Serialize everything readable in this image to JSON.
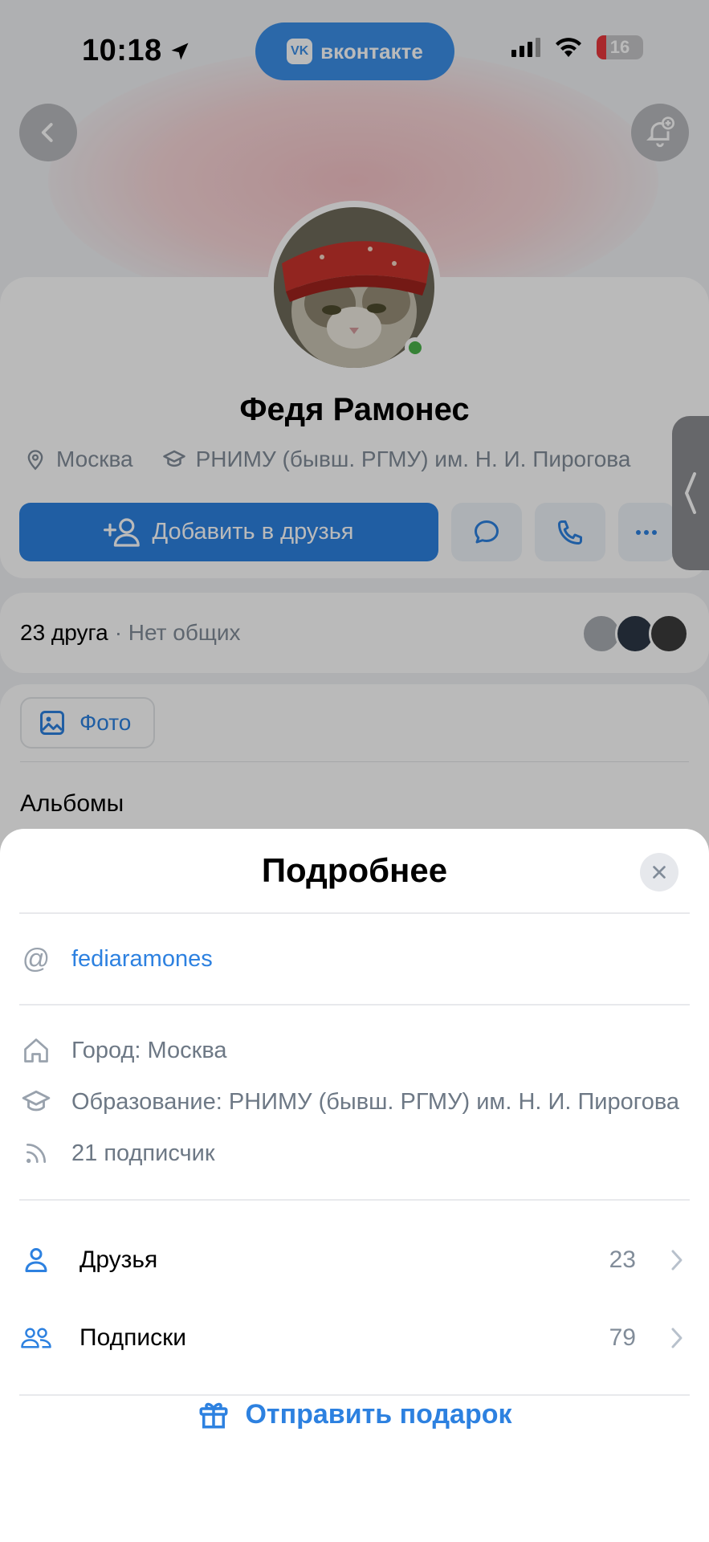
{
  "status_bar": {
    "time": "10:18",
    "app_pill": "вконтакте",
    "vk_logo": "VK",
    "battery": "16",
    "icons": [
      "location-arrow-icon",
      "signal-icon",
      "wifi-icon",
      "battery-icon"
    ]
  },
  "profile": {
    "name": "Федя Рамонес",
    "city": "Москва",
    "university": "РНИМУ (бывш. РГМУ) им. Н. И. Пирогова",
    "add_friend_label": "Добавить в друзья",
    "friends_count_label": "23 друга",
    "common_friends_label": "· Нет общих",
    "photo_chip_label": "Фото",
    "albums_label": "Альбомы"
  },
  "sheet": {
    "title": "Подробнее",
    "username": "fediaramones",
    "city": "Город: Москва",
    "education": "Образование: РНИМУ (бывш. РГМУ) им. Н. И. Пирогова",
    "followers": "21 подписчик",
    "nav": [
      {
        "label": "Друзья",
        "count": "23"
      },
      {
        "label": "Подписки",
        "count": "79"
      }
    ],
    "gift_label": "Отправить подарок"
  },
  "colors": {
    "accent": "#2d81e0",
    "vk_blue": "#3b8fe8",
    "online": "#4bb34b",
    "secondary_text": "#818c99"
  }
}
